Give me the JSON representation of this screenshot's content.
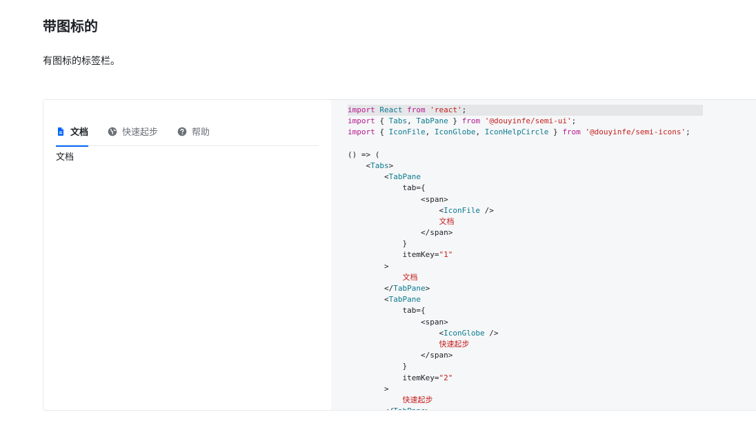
{
  "section": {
    "title": "带图标的",
    "description": "有图标的标签栏。"
  },
  "preview": {
    "tabs": [
      {
        "label": "文档",
        "icon": "file-icon",
        "active": true
      },
      {
        "label": "快速起步",
        "icon": "globe-icon",
        "active": false
      },
      {
        "label": "帮助",
        "icon": "help-circle-icon",
        "active": false
      }
    ],
    "active_content": "文档"
  },
  "code": {
    "lines": [
      [
        [
          "kw",
          "import"
        ],
        [
          "pn",
          " "
        ],
        [
          "id",
          "React"
        ],
        [
          "pn",
          " "
        ],
        [
          "kw",
          "from"
        ],
        [
          "pn",
          " "
        ],
        [
          "str",
          "'react'"
        ],
        [
          "pn",
          ";"
        ]
      ],
      [
        [
          "kw",
          "import"
        ],
        [
          "pn",
          " { "
        ],
        [
          "id",
          "Tabs"
        ],
        [
          "pn",
          ", "
        ],
        [
          "id",
          "TabPane"
        ],
        [
          "pn",
          " } "
        ],
        [
          "kw",
          "from"
        ],
        [
          "pn",
          " "
        ],
        [
          "str",
          "'@douyinfe/semi-ui'"
        ],
        [
          "pn",
          ";"
        ]
      ],
      [
        [
          "kw",
          "import"
        ],
        [
          "pn",
          " { "
        ],
        [
          "id",
          "IconFile"
        ],
        [
          "pn",
          ", "
        ],
        [
          "id",
          "IconGlobe"
        ],
        [
          "pn",
          ", "
        ],
        [
          "id",
          "IconHelpCircle"
        ],
        [
          "pn",
          " } "
        ],
        [
          "kw",
          "from"
        ],
        [
          "pn",
          " "
        ],
        [
          "str",
          "'@douyinfe/semi-icons'"
        ],
        [
          "pn",
          ";"
        ]
      ],
      [
        [
          "pn",
          ""
        ]
      ],
      [
        [
          "pn",
          "() => ("
        ]
      ],
      [
        [
          "pn",
          "    <"
        ],
        [
          "id",
          "Tabs"
        ],
        [
          "pn",
          ">"
        ]
      ],
      [
        [
          "pn",
          "        <"
        ],
        [
          "id",
          "TabPane"
        ]
      ],
      [
        [
          "pn",
          "            tab={"
        ]
      ],
      [
        [
          "pn",
          "                <span>"
        ]
      ],
      [
        [
          "pn",
          "                    <"
        ],
        [
          "id",
          "IconFile"
        ],
        [
          "pn",
          " />"
        ]
      ],
      [
        [
          "pn",
          "                    "
        ],
        [
          "str",
          "文档"
        ]
      ],
      [
        [
          "pn",
          "                </span>"
        ]
      ],
      [
        [
          "pn",
          "            }"
        ]
      ],
      [
        [
          "pn",
          "            itemKey="
        ],
        [
          "str",
          "\"1\""
        ]
      ],
      [
        [
          "pn",
          "        >"
        ]
      ],
      [
        [
          "pn",
          "            "
        ],
        [
          "str",
          "文档"
        ]
      ],
      [
        [
          "pn",
          "        </"
        ],
        [
          "id",
          "TabPane"
        ],
        [
          "pn",
          ">"
        ]
      ],
      [
        [
          "pn",
          "        <"
        ],
        [
          "id",
          "TabPane"
        ]
      ],
      [
        [
          "pn",
          "            tab={"
        ]
      ],
      [
        [
          "pn",
          "                <span>"
        ]
      ],
      [
        [
          "pn",
          "                    <"
        ],
        [
          "id",
          "IconGlobe"
        ],
        [
          "pn",
          " />"
        ]
      ],
      [
        [
          "pn",
          "                    "
        ],
        [
          "str",
          "快速起步"
        ]
      ],
      [
        [
          "pn",
          "                </span>"
        ]
      ],
      [
        [
          "pn",
          "            }"
        ]
      ],
      [
        [
          "pn",
          "            itemKey="
        ],
        [
          "str",
          "\"2\""
        ]
      ],
      [
        [
          "pn",
          "        >"
        ]
      ],
      [
        [
          "pn",
          "            "
        ],
        [
          "str",
          "快速起步"
        ]
      ],
      [
        [
          "pn",
          "        </"
        ],
        [
          "id",
          "TabPane"
        ],
        [
          "pn",
          ">"
        ]
      ]
    ]
  },
  "colors": {
    "accent": "#0064fa",
    "keyword": "#b5188f",
    "identifier": "#0b7a8f",
    "string": "#c41d1d"
  }
}
